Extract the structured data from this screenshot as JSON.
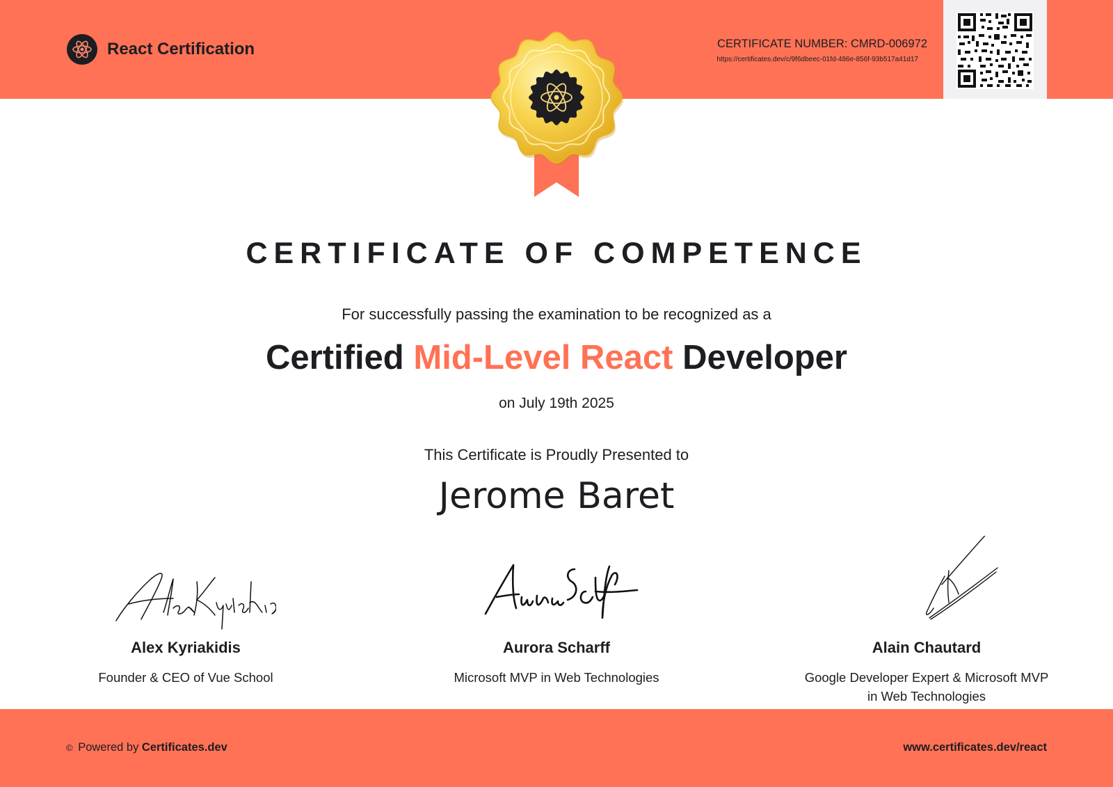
{
  "colors": {
    "accent": "#ff7255",
    "text": "#1d1d22",
    "seal_gold": "#f5c842",
    "qr_background": "#f1f1f3"
  },
  "header": {
    "brand_name": "React Certification",
    "brand_icon": "react-atom-icon",
    "certificate_number": "CERTIFICATE NUMBER: CMRD-006972",
    "certificate_url": "https://certificates.dev/c/9f6dbeec-01fd-486e-856f-93b517a41d17",
    "qr_icon": "qr-code"
  },
  "seal": {
    "icon": "react-atom-icon"
  },
  "certificate": {
    "title": "CERTIFICATE OF COMPETENCE",
    "intro": "For successfully passing the examination to be recognized as a",
    "headline_prefix": "Certified",
    "headline_accent": "Mid-Level React",
    "headline_suffix": "Developer",
    "date": "on July 19th 2025",
    "presented_to": "This Certificate is Proudly Presented to",
    "recipient": "Jerome Baret"
  },
  "signers": [
    {
      "name": "Alex Kyriakidis",
      "role": "Founder & CEO of Vue School"
    },
    {
      "name": "Aurora Scharff",
      "role": "Microsoft MVP in Web Technologies"
    },
    {
      "name": "Alain Chautard",
      "role": "Google Developer Expert & Microsoft MVP in Web Technologies"
    }
  ],
  "footer": {
    "powered_by_prefix": "Powered by",
    "powered_by_brand": "Certificates.dev",
    "url": "www.certificates.dev/react"
  }
}
